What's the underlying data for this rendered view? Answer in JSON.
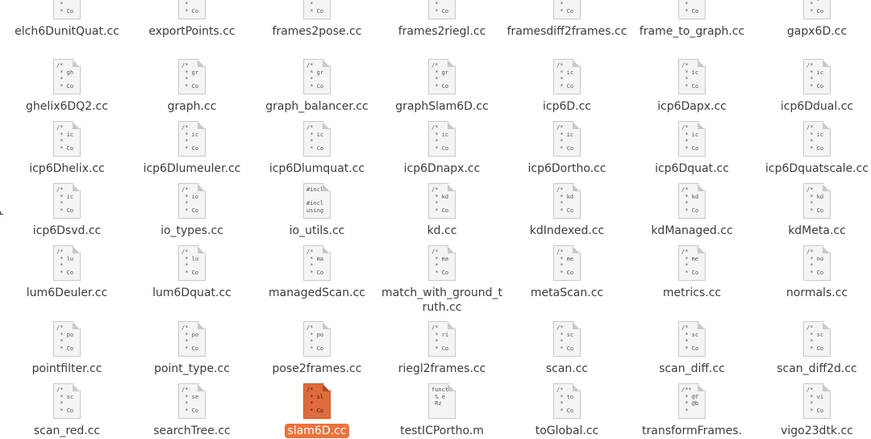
{
  "files": [
    {
      "name": "elch6DunitQuat.cc",
      "icon_text": "/*\n * el\n *\n * Co"
    },
    {
      "name": "exportPoints.cc",
      "icon_text": "/*\n * ex\n *\n * Co"
    },
    {
      "name": "frames2pose.cc",
      "icon_text": "/*\n * fr\n *\n * Co"
    },
    {
      "name": "frames2riegl.cc",
      "icon_text": "/*\n * fr\n *\n * Co"
    },
    {
      "name": "framesdiff2frames.cc",
      "icon_text": "/*\n * fr\n *\n * Co"
    },
    {
      "name": "frame_to_graph.cc",
      "icon_text": "/*\n * fr\n *\n * Co"
    },
    {
      "name": "gapx6D.cc",
      "icon_text": "/*\n * ga\n *\n * Co"
    },
    {
      "name": "ghelix6DQ2.cc",
      "icon_text": "/*\n * gh\n *\n * Co"
    },
    {
      "name": "graph.cc",
      "icon_text": "/*\n * gr\n *\n * Co"
    },
    {
      "name": "graph_balancer.cc",
      "icon_text": "/*\n * gr\n *\n * Co"
    },
    {
      "name": "graphSlam6D.cc",
      "icon_text": "/*\n * gr\n *\n * Co"
    },
    {
      "name": "icp6D.cc",
      "icon_text": "/*\n * ic\n *\n * Co"
    },
    {
      "name": "icp6Dapx.cc",
      "icon_text": "/*\n * ic\n *\n * Co"
    },
    {
      "name": "icp6Ddual.cc",
      "icon_text": "/*\n * ic\n *\n * Co"
    },
    {
      "name": "icp6Dhelix.cc",
      "icon_text": "/*\n * ic\n *\n * Co"
    },
    {
      "name": "icp6Dlumeuler.cc",
      "icon_text": "/*\n * ic\n *\n * Co"
    },
    {
      "name": "icp6Dlumquat.cc",
      "icon_text": "/*\n * ic\n *\n * Co"
    },
    {
      "name": "icp6Dnapx.cc",
      "icon_text": "/*\n * ic\n *\n * Co"
    },
    {
      "name": "icp6Dortho.cc",
      "icon_text": "/*\n * ic\n *\n * Co"
    },
    {
      "name": "icp6Dquat.cc",
      "icon_text": "/*\n * ic\n *\n * Co"
    },
    {
      "name": "icp6Dquatscale.cc",
      "icon_text": "/*\n * ic\n *\n * Co"
    },
    {
      "name": "icp6Dsvd.cc",
      "icon_text": "/*\n * ic\n *\n * Co"
    },
    {
      "name": "io_types.cc",
      "icon_text": "/*\n * io\n *\n * Co"
    },
    {
      "name": "io_utils.cc",
      "icon_text": "#incl\n\n#incl\nusing"
    },
    {
      "name": "kd.cc",
      "icon_text": "/*\n * kd\n *\n * Co"
    },
    {
      "name": "kdIndexed.cc",
      "icon_text": "/*\n * kd\n *\n * Co"
    },
    {
      "name": "kdManaged.cc",
      "icon_text": "/*\n * kd\n *\n * Co"
    },
    {
      "name": "kdMeta.cc",
      "icon_text": "/*\n * kd\n *\n * Co"
    },
    {
      "name": "lum6Deuler.cc",
      "icon_text": "/*\n * lu\n *\n * Co"
    },
    {
      "name": "lum6Dquat.cc",
      "icon_text": "/*\n * lu\n *\n * Co"
    },
    {
      "name": "managedScan.cc",
      "icon_text": "/*\n * ma\n *\n * Co"
    },
    {
      "name": "match_with_ground_truth.cc",
      "icon_text": "/*\n * ma\n *\n * Co"
    },
    {
      "name": "metaScan.cc",
      "icon_text": "/*\n * me\n *\n * Co"
    },
    {
      "name": "metrics.cc",
      "icon_text": "/*\n * me\n *\n * Co"
    },
    {
      "name": "normals.cc",
      "icon_text": "/*\n * no\n *\n * Co"
    },
    {
      "name": "pointfilter.cc",
      "icon_text": "/*\n * po\n *\n * Co"
    },
    {
      "name": "point_type.cc",
      "icon_text": "/*\n * po\n *\n * Co"
    },
    {
      "name": "pose2frames.cc",
      "icon_text": "/*\n * po\n *\n * Co"
    },
    {
      "name": "riegl2frames.cc",
      "icon_text": "/*\n * ri\n *\n * Co"
    },
    {
      "name": "scan.cc",
      "icon_text": "/*\n * sc\n *\n * Co"
    },
    {
      "name": "scan_diff.cc",
      "icon_text": "/*\n * sc\n *\n * Co"
    },
    {
      "name": "scan_diff2d.cc",
      "icon_text": "/*\n * sc\n *\n * Co"
    },
    {
      "name": "scan_red.cc",
      "icon_text": "/*\n * sc\n *\n * Co"
    },
    {
      "name": "searchTree.cc",
      "icon_text": "/*\n * se\n *\n * Co"
    },
    {
      "name": "slam6D.cc",
      "icon_text": "/*\n * sl\n *\n * Co",
      "selected": true
    },
    {
      "name": "testICPortho.m",
      "icon_text": "funct\n % e\n Rz"
    },
    {
      "name": "toGlobal.cc",
      "icon_text": "/*\n * to\n *\n * Co"
    },
    {
      "name": "transformFrames.",
      "icon_text": "/**\n * @f\n * @b\n *"
    },
    {
      "name": "vigo23dtk.cc",
      "icon_text": "/*\n * vi\n *\n * Co"
    }
  ],
  "colors": {
    "selection": "#e8743f",
    "label_text": "#3c3c3c"
  }
}
